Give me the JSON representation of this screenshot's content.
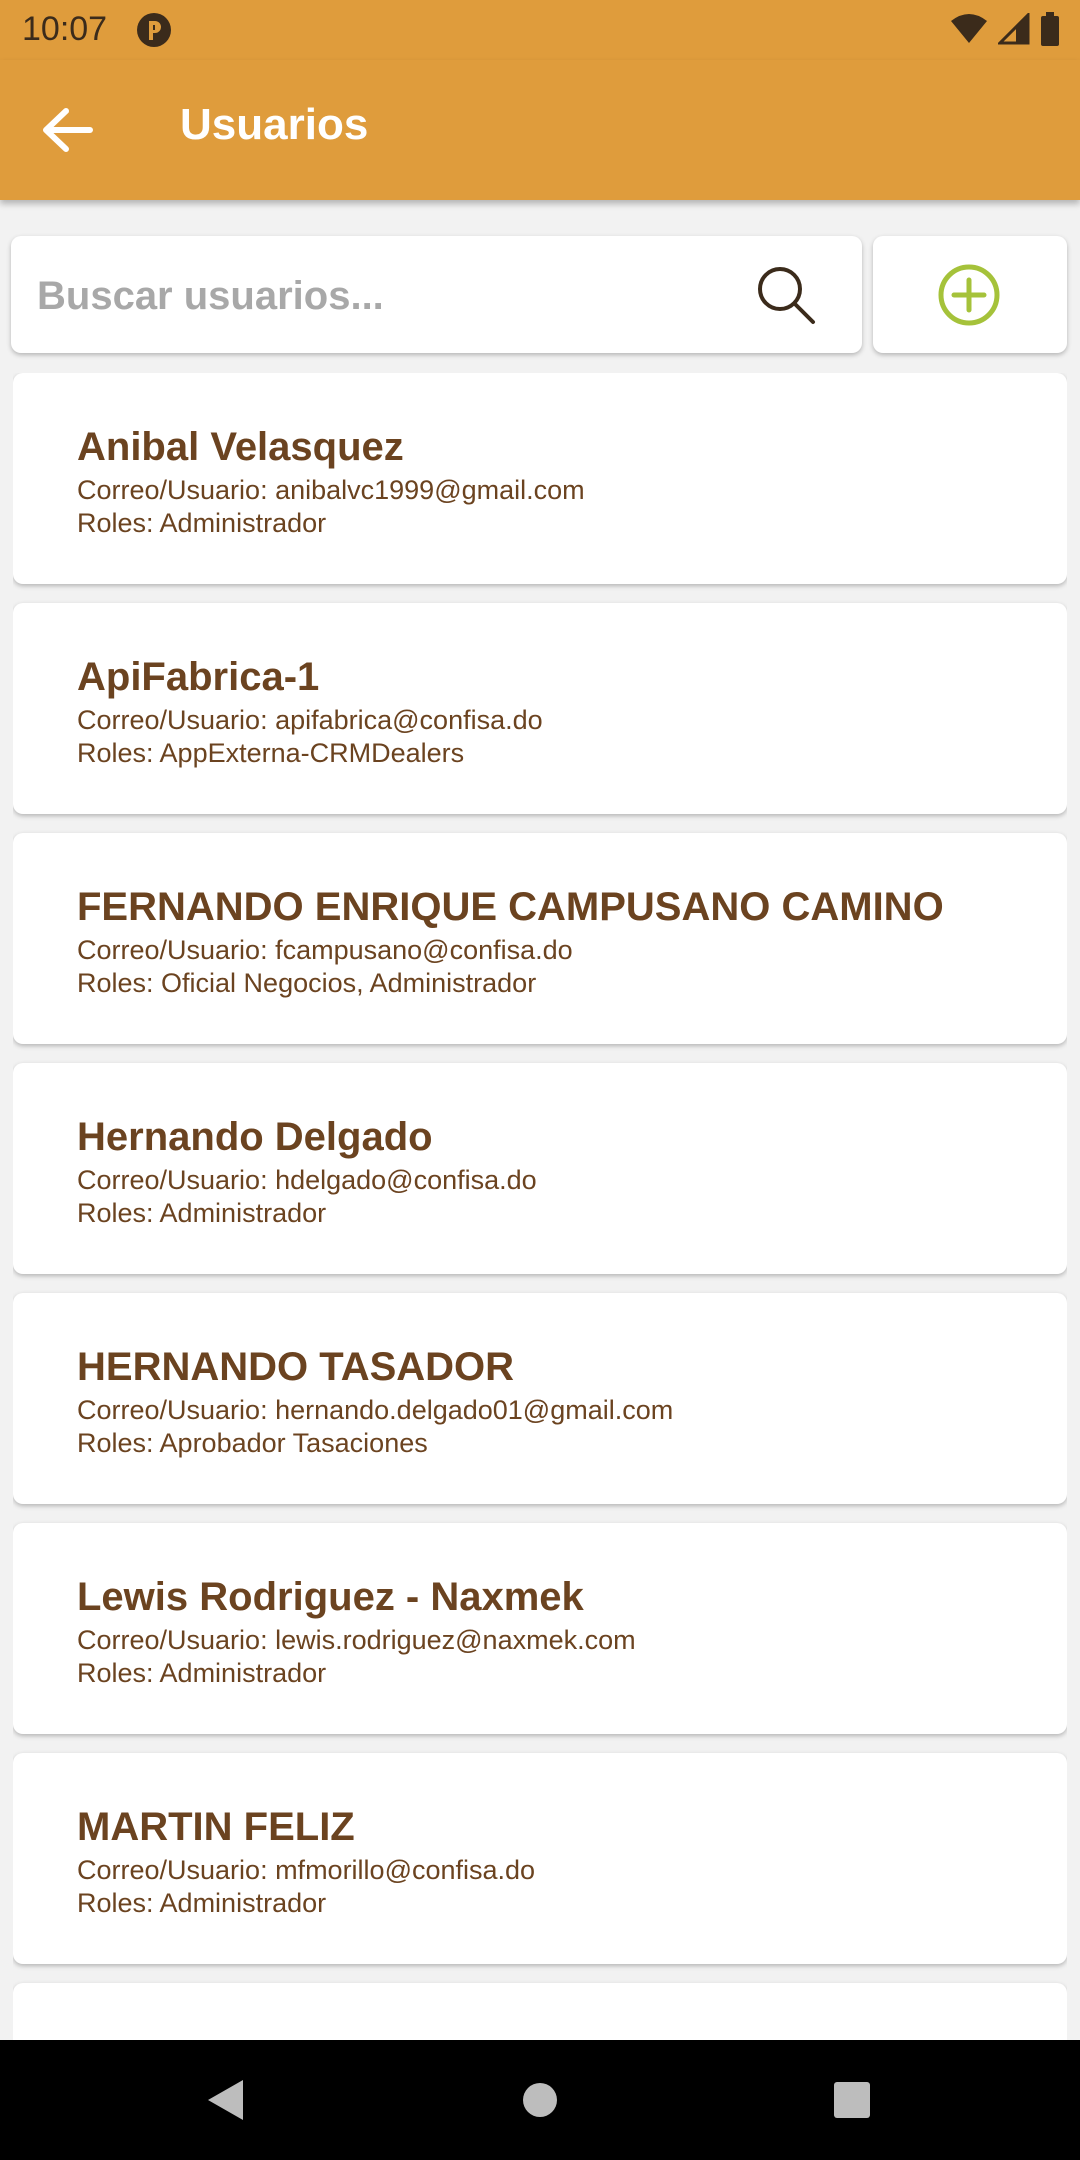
{
  "status_bar": {
    "time": "10:07",
    "icons": [
      "app-notification-icon",
      "wifi-icon",
      "signal-icon",
      "battery-icon"
    ]
  },
  "app_bar": {
    "back_icon": "arrow-left-icon",
    "title": "Usuarios",
    "color": "#df9c3c"
  },
  "search": {
    "placeholder": "Buscar usuarios...",
    "value": "",
    "icon": "search-icon"
  },
  "add_button": {
    "icon": "plus-circle-icon",
    "color": "#a5c23a"
  },
  "users": [
    {
      "name": "Anibal Velasquez",
      "email": "Correo/Usuario: anibalvc1999@gmail.com",
      "roles": "Roles: Administrador"
    },
    {
      "name": "ApiFabrica-1",
      "email": "Correo/Usuario: apifabrica@confisa.do",
      "roles": "Roles: AppExterna-CRMDealers"
    },
    {
      "name": "FERNANDO ENRIQUE CAMPUSANO CAMINO",
      "email": "Correo/Usuario: fcampusano@confisa.do",
      "roles": "Roles: Oficial Negocios, Administrador"
    },
    {
      "name": "Hernando Delgado",
      "email": "Correo/Usuario: hdelgado@confisa.do",
      "roles": "Roles: Administrador"
    },
    {
      "name": "HERNANDO TASADOR",
      "email": "Correo/Usuario: hernando.delgado01@gmail.com",
      "roles": "Roles: Aprobador Tasaciones"
    },
    {
      "name": "Lewis Rodriguez - Naxmek",
      "email": "Correo/Usuario: lewis.rodriguez@naxmek.com",
      "roles": "Roles: Administrador"
    },
    {
      "name": "MARTIN FELIZ",
      "email": "Correo/Usuario: mfmorillo@confisa.do",
      "roles": "Roles: Administrador"
    }
  ],
  "nav_bar": {
    "buttons": [
      "back-triangle-icon",
      "home-circle-icon",
      "recents-square-icon"
    ]
  }
}
